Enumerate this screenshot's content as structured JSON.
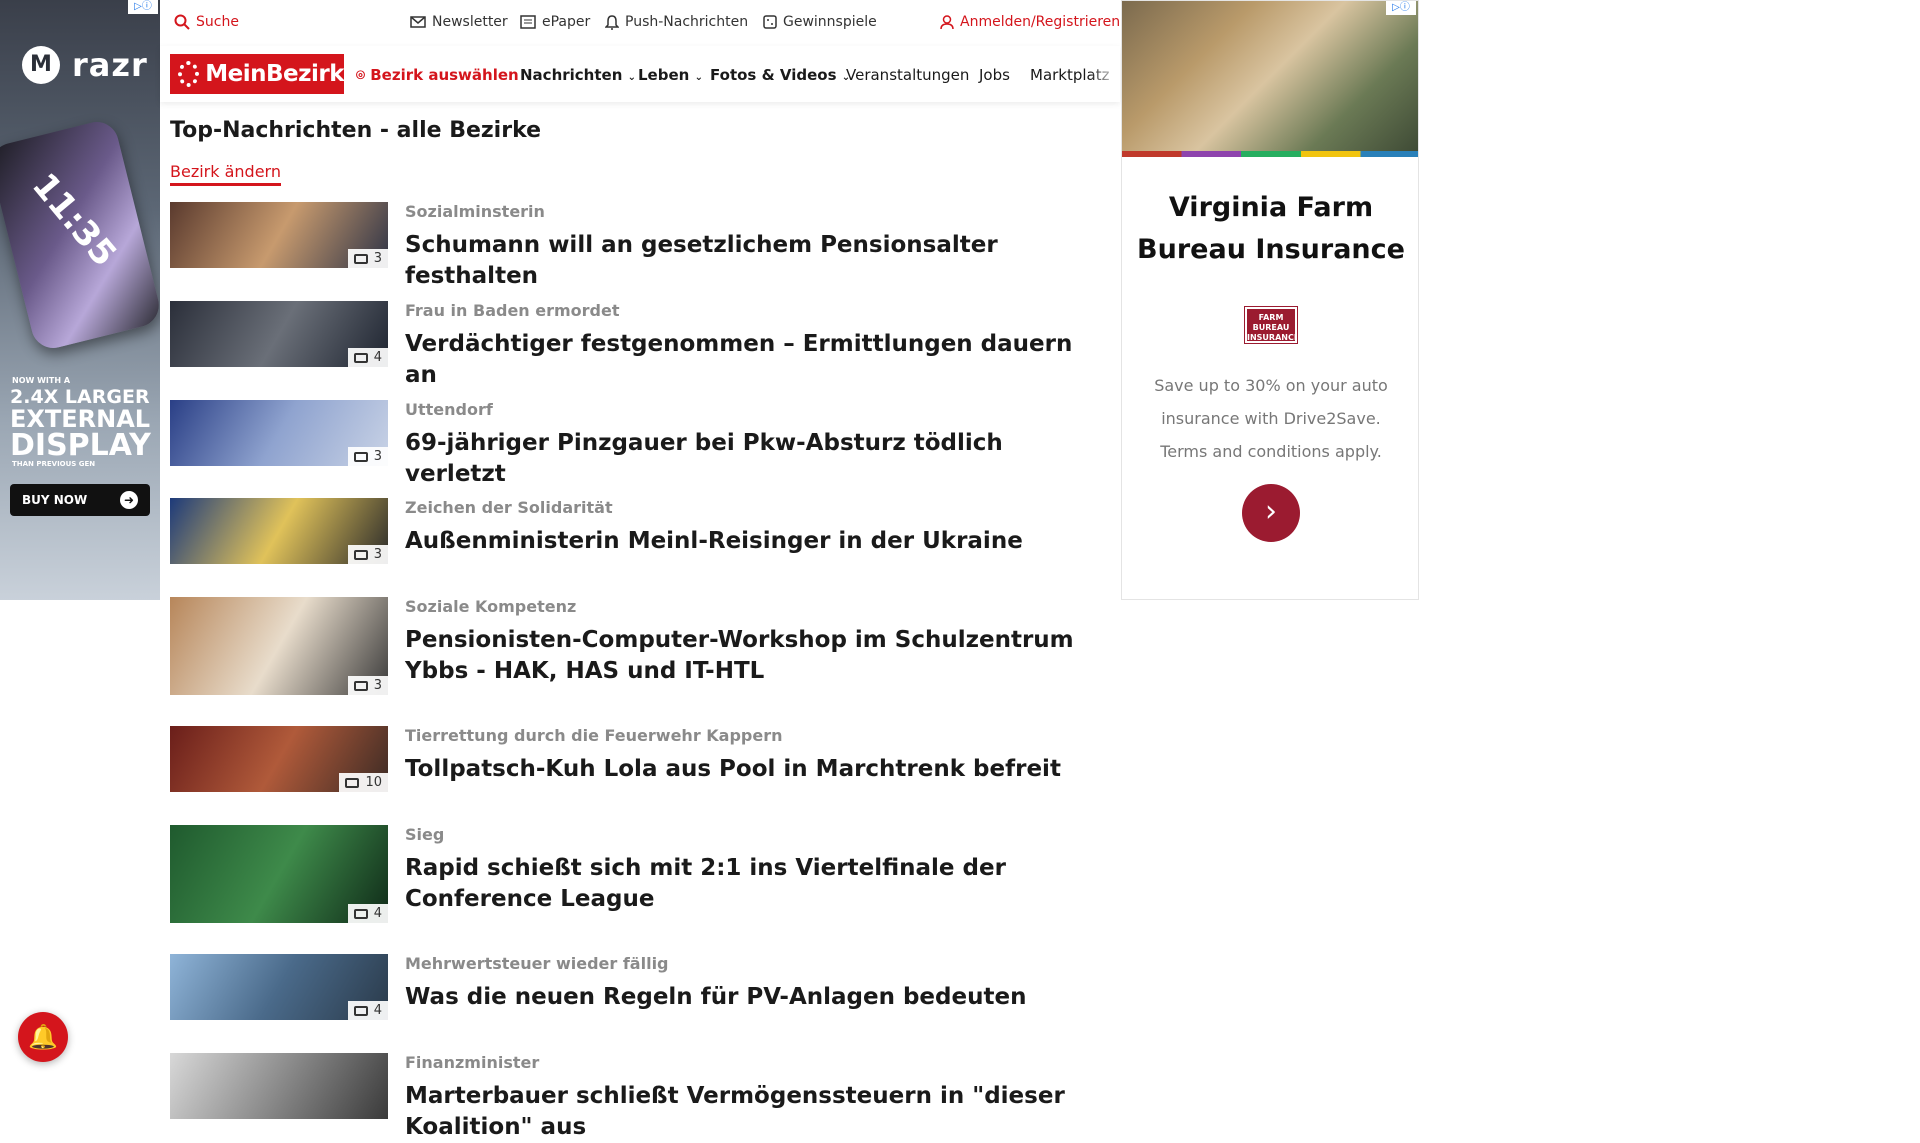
{
  "left_ad": {
    "adchoices": "▷ⓘ",
    "brand_mark": "M",
    "brand": "razr",
    "phone_time": "11:35",
    "tagline_small": "NOW WITH A",
    "tagline_line1": "2.4X LARGER",
    "tagline_line2": "EXTERNAL",
    "tagline_line3": "DISPLAY",
    "tagline_tiny": "THAN PREVIOUS GEN",
    "cta": "BUY NOW"
  },
  "topbar": {
    "search": "Suche",
    "newsletter": "Newsletter",
    "epaper": "ePaper",
    "push": "Push-Nachrichten",
    "games": "Gewinnspiele",
    "login": "Anmelden/Registrieren"
  },
  "nav": {
    "logo": "MeinBezirk",
    "district": "Bezirk auswählen",
    "items": [
      "Nachrichten",
      "Leben",
      "Fotos & Videos",
      "Veranstaltungen",
      "Jobs",
      "Marktplatz"
    ]
  },
  "page": {
    "title": "Top-Nachrichten - alle Bezirke",
    "change_district": "Bezirk ändern"
  },
  "articles": [
    {
      "kicker": "Sozialminsterin",
      "headline": "Schumann will an gesetzlichem Pensionsalter festhalten",
      "count": "3",
      "colors": [
        "#5a3a2e",
        "#c79a6e",
        "#2e3346"
      ]
    },
    {
      "kicker": "Frau in Baden ermordet",
      "headline": "Verdächtiger festgenommen – Ermittlungen dauern an",
      "count": "4",
      "colors": [
        "#2b2f3a",
        "#6a6f78",
        "#1e2430"
      ]
    },
    {
      "kicker": "Uttendorf",
      "headline": "69-jähriger Pinzgauer bei Pkw-Absturz tödlich verletzt",
      "count": "3",
      "colors": [
        "#2a3f86",
        "#8fa3cf",
        "#c9d3e6"
      ]
    },
    {
      "kicker": "Zeichen der Solidarität",
      "headline": "Außenministerin Meinl-Reisinger in der Ukraine",
      "count": "3",
      "colors": [
        "#1d3a7a",
        "#e0c25a",
        "#2a2a2a"
      ]
    },
    {
      "kicker": "Soziale Kompetenz",
      "headline": "Pensionisten-Computer-Workshop im Schulzentrum Ybbs - HAK, HAS und IT-HTL",
      "count": "3",
      "colors": [
        "#b7865a",
        "#e8dccb",
        "#3a3a3a"
      ]
    },
    {
      "kicker": "Tierrettung durch die Feuerwehr Kappern",
      "headline": "Tollpatsch-Kuh Lola aus Pool in Marchtrenk befreit",
      "count": "10",
      "colors": [
        "#6a1e1a",
        "#b05a3a",
        "#3b2a24"
      ]
    },
    {
      "kicker": "Sieg",
      "headline": "Rapid schießt sich mit 2:1 ins Viertelfinale der Conference League",
      "count": "4",
      "colors": [
        "#1f5a2e",
        "#3e8a4a",
        "#0f2a18"
      ]
    },
    {
      "kicker": "Mehrwertsteuer wieder fällig",
      "headline": "Was die neuen Regeln für PV-Anlagen bedeuten",
      "count": "4",
      "colors": [
        "#8fb4d8",
        "#4a6a8a",
        "#2a3a4a"
      ]
    },
    {
      "kicker": "Finanzminister",
      "headline": "Marterbauer schließt Vermögenssteuern in \"dieser Koalition\" aus",
      "count": "",
      "colors": [
        "#d8d8d8",
        "#8a8a8a",
        "#3a3a3a"
      ]
    }
  ],
  "right_ad": {
    "adchoices": "▷ⓘ",
    "title": "Virginia Farm Bureau Insurance",
    "logo": "FARM BUREAU INSURANCE",
    "text": "Save up to 30% on your auto insurance with Drive2Save. Terms and conditions apply.",
    "cta_icon": "›"
  },
  "bell_icon": "🔔"
}
